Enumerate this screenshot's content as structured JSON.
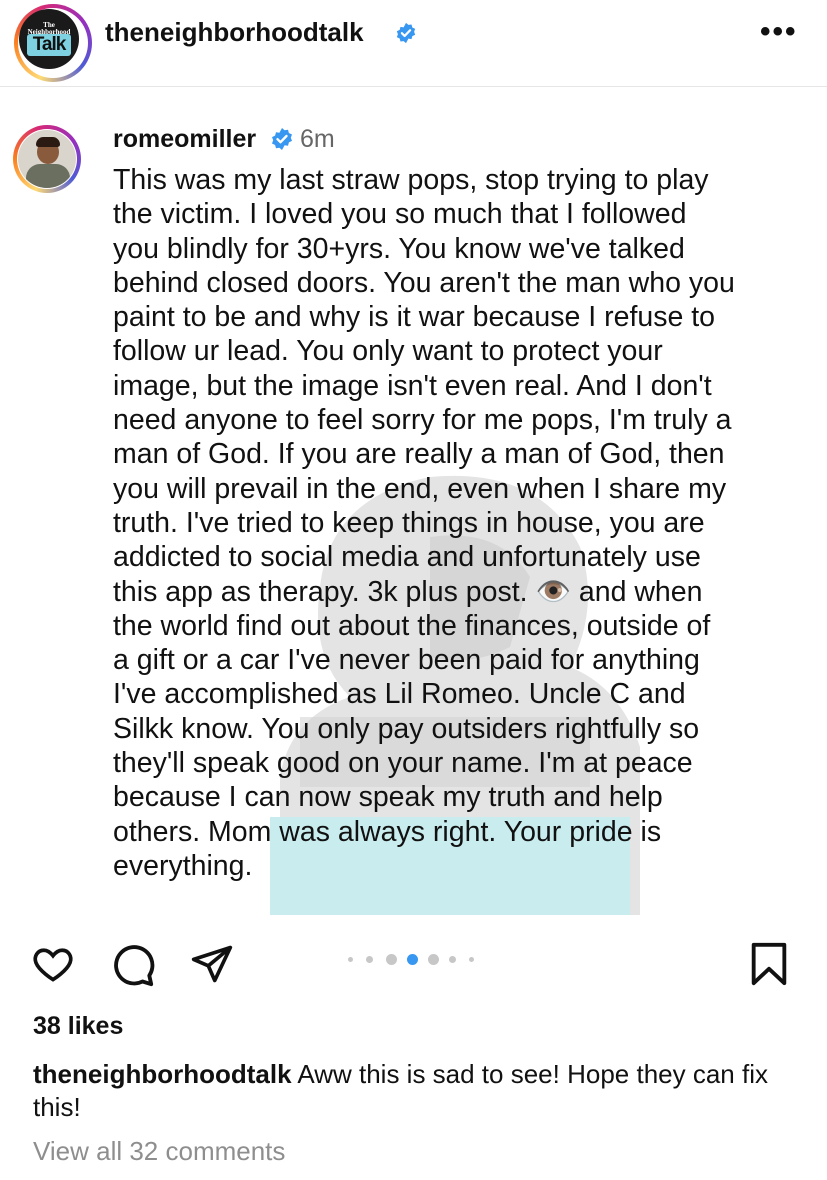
{
  "header": {
    "account_name": "theneighborhoodtalk",
    "logo_text_small": "The\nNeighborhood",
    "logo_text_big": "Talk",
    "more_label": "•••"
  },
  "post": {
    "username": "romeomiller",
    "time": "6m",
    "text": "This was my last straw pops, stop trying to play\nthe victim. I loved you so much that I followed\nyou blindly for 30+yrs. You know we've talked\nbehind closed doors. You aren't the man who you\npaint to be and why is it war because I refuse to\nfollow ur lead. You only want to protect your\nimage, but the image isn't even real. And I don't\nneed anyone to feel sorry for me pops, I'm truly a\nman of God. If you are really a man of God, then\nyou will prevail in the end, even when I share my\ntruth. I've tried to keep things in house, you are\naddicted to social media and unfortunately use\nthis app as therapy. 3k plus post. 👁️ and when\nthe world find out about the finances, outside of\na gift or a car I've never been paid for anything\nI've accomplished as Lil Romeo. Uncle C and\nSilkk know. You only pay outsiders rightfully so\nthey'll speak good on your name. I'm at peace\nbecause I can now speak my truth and help\nothers. Mom was always right. Your pride is\neverything."
  },
  "actions": {
    "icons": [
      "heart-icon",
      "comment-icon",
      "share-icon",
      "bookmark-icon"
    ],
    "carousel_dots": 7,
    "active_dot": 3,
    "accent_color": "#3897f0"
  },
  "likes": "38 likes",
  "caption": {
    "username": "theneighborhoodtalk",
    "text": " Aww this is sad to see! Hope they can fix this!"
  },
  "view_all_comments": "View all 32 comments"
}
